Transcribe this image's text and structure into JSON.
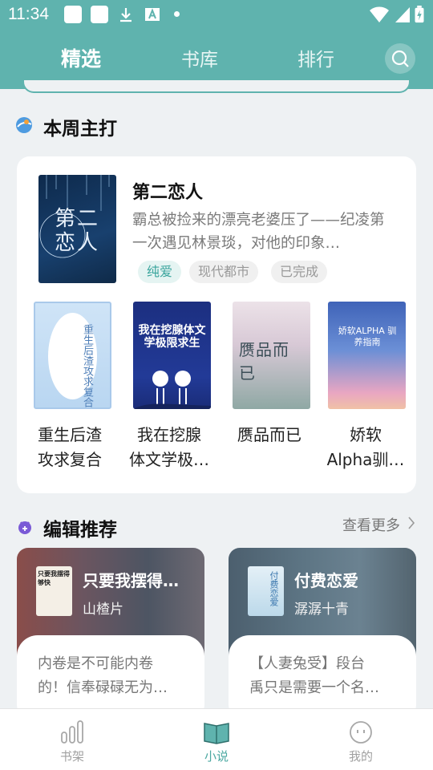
{
  "status_bar": {
    "time": "11:34"
  },
  "nav": {
    "tabs": [
      {
        "label": "精选",
        "active": true
      },
      {
        "label": "书库"
      },
      {
        "label": "排行"
      }
    ]
  },
  "featured_section": {
    "title": "本周主打"
  },
  "featured_book": {
    "title": "第二恋人",
    "description": "霸总被捡来的漂亮老婆压了——纪凌第一次遇见林景琰，对他的印象…",
    "tags": [
      "纯爱",
      "现代都市",
      "已完成"
    ],
    "cover_text": "第二恋人"
  },
  "books": [
    {
      "title_line1": "重生后渣",
      "title_line2": "攻求复合",
      "cover_text": "重生后渣攻求复合"
    },
    {
      "title_line1": "我在挖腺",
      "title_line2": "体文学极…",
      "cover_text": "我在挖腺体文学极限求生"
    },
    {
      "title_line1": "赝品而已",
      "title_line2": "",
      "cover_text": "赝品而已"
    },
    {
      "title_line1": "娇软",
      "title_line2": "Alpha驯…",
      "cover_text": "娇软ALPHA 驯养指南"
    }
  ],
  "editor_section": {
    "title": "编辑推荐",
    "more_label": "查看更多"
  },
  "recommendations": [
    {
      "title": "只要我摆得…",
      "author": "山楂片",
      "desc_line1": "内卷是不可能内卷",
      "desc_line2": "的！信奉碌碌无为…",
      "cover_text": "只要我摆得够快"
    },
    {
      "title": "付费恋爱",
      "author": "潺潺十青",
      "desc_line1": "【人妻兔受】段台",
      "desc_line2": "禹只是需要一个名…",
      "cover_text": "付费恋爱"
    }
  ],
  "bottom_nav": [
    {
      "label": "书架",
      "icon": "bookshelf-icon"
    },
    {
      "label": "小说",
      "icon": "open-book-icon",
      "active": true
    },
    {
      "label": "我的",
      "icon": "profile-icon"
    }
  ],
  "colors": {
    "accent": "#5fb3ae",
    "tag_highlight": "#3aa59d"
  }
}
